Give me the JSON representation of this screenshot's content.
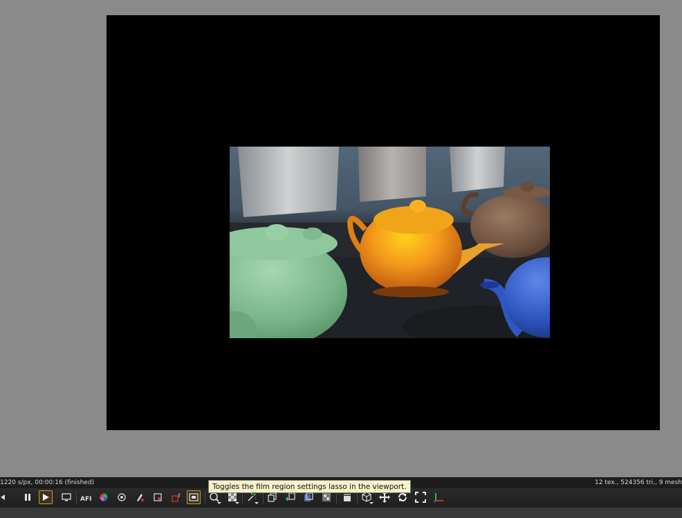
{
  "status": {
    "left_text": "1220 s/px, 00:00:16 (finished)",
    "right_text": "12 tex., 524356 tri., 9 mesh"
  },
  "tooltip": {
    "text": "Toggles the film region settings lasso in the viewport."
  },
  "toolbar": {
    "active_color": "#c9a227",
    "buttons": [
      "previous-icon",
      "pause-icon",
      "play-icon",
      "monitor-icon",
      "afi-icon",
      "color-wheel-icon",
      "material-picker-icon",
      "object-picker-icon",
      "camera-target-icon",
      "render-region-icon",
      "film-region-icon",
      "zoom-icon",
      "checker-icon",
      "sparkle-icon",
      "copy-icon",
      "save-icon",
      "export-icon",
      "texture-icon",
      "clapper-icon",
      "cube-icon",
      "move-icon",
      "rotate-icon",
      "fullscreen-icon",
      "axes-icon"
    ]
  }
}
